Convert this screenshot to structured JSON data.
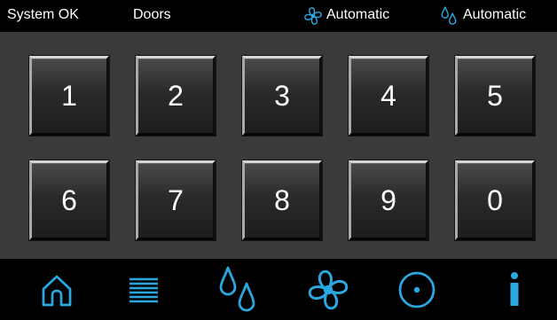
{
  "status_bar": {
    "system_status": "System OK",
    "doors_label": "Doors",
    "fan_mode": {
      "icon": "fan-icon",
      "label": "Automatic"
    },
    "humidity_mode": {
      "icon": "water-drops-icon",
      "label": "Automatic"
    }
  },
  "keypad": {
    "rows": [
      [
        "1",
        "2",
        "3",
        "4",
        "5"
      ],
      [
        "6",
        "7",
        "8",
        "9",
        "0"
      ]
    ]
  },
  "nav": {
    "items": [
      {
        "icon": "home-icon"
      },
      {
        "icon": "menu-lines-icon"
      },
      {
        "icon": "water-drops-icon"
      },
      {
        "icon": "fan-icon"
      },
      {
        "icon": "circle-dot-icon"
      },
      {
        "icon": "info-icon"
      }
    ]
  },
  "colors": {
    "accent": "#2aa7de",
    "status_bar_bg": "#000000",
    "keypad_bg": "#3a3a3a",
    "key_text": "#ffffff"
  }
}
